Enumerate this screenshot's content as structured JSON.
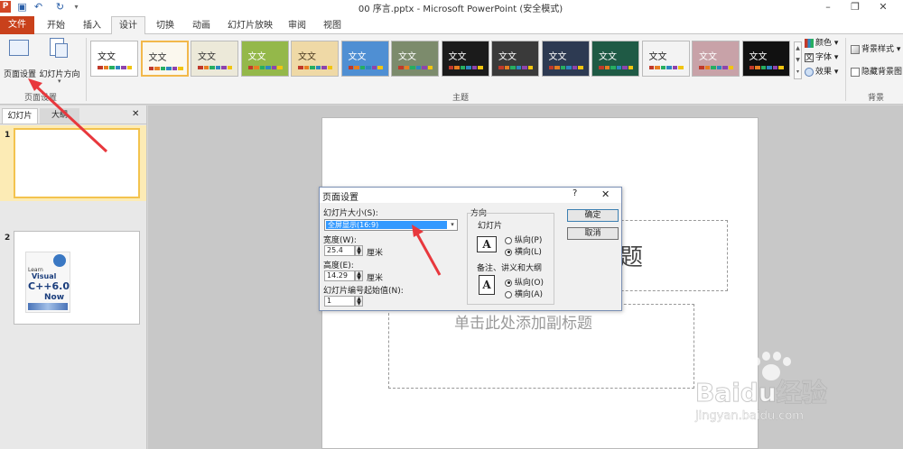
{
  "titlebar": {
    "title": "00 序言.pptx - Microsoft PowerPoint (安全模式)",
    "logo": "P",
    "qat_icons": [
      "save-icon",
      "undo-icon",
      "redo-icon",
      "customize-qat-icon"
    ],
    "window_controls": [
      "minimize-icon",
      "restore-icon",
      "close-icon"
    ]
  },
  "tabs": [
    "文件",
    "开始",
    "插入",
    "设计",
    "切换",
    "动画",
    "幻灯片放映",
    "审阅",
    "视图"
  ],
  "active_tab": "设计",
  "ribbon": {
    "page_setup_group": {
      "label": "页面设置",
      "page_setup_button": "页面设置",
      "orientation_button": "幻灯片方向"
    },
    "themes_group": {
      "label": "主题",
      "theme_text": "文文",
      "themes": [
        {
          "bg": "#ffffff",
          "fg": "#222222"
        },
        {
          "bg": "#fbf8ee",
          "fg": "#333333"
        },
        {
          "bg": "#ece9d9",
          "fg": "#333333"
        },
        {
          "bg": "#94b84a",
          "fg": "#ffffff"
        },
        {
          "bg": "#efd9a6",
          "fg": "#4a3a20"
        },
        {
          "bg": "#4f8fd3",
          "fg": "#ffffff"
        },
        {
          "bg": "#7c8b6c",
          "fg": "#ffffff"
        },
        {
          "bg": "#1b1b1b",
          "fg": "#ffffff"
        },
        {
          "bg": "#3a3a3a",
          "fg": "#ffffff"
        },
        {
          "bg": "#2d3a52",
          "fg": "#ffffff"
        },
        {
          "bg": "#1f5a45",
          "fg": "#ffffff"
        },
        {
          "bg": "#f3f3f3",
          "fg": "#222222"
        },
        {
          "bg": "#c8a2a8",
          "fg": "#ffffff"
        },
        {
          "bg": "#111111",
          "fg": "#ffffff"
        }
      ],
      "colors_label": "颜色",
      "fonts_label": "字体",
      "effects_label": "效果"
    },
    "background_group": {
      "label": "背景",
      "bg_styles_label": "背景样式",
      "hide_bg_label": "隐藏背景图"
    }
  },
  "left_pane": {
    "tabs": [
      "幻灯片",
      "大纲"
    ],
    "close": "✕",
    "thumbnails": [
      {
        "number": "1"
      },
      {
        "number": "2",
        "cover_lines": [
          "Learn",
          "Visual",
          "C++6.0",
          "Now"
        ]
      }
    ]
  },
  "slide": {
    "title_fragment": "题",
    "subtitle_placeholder": "单击此处添加副标题"
  },
  "dialog": {
    "title": "页面设置",
    "help": "?",
    "close": "✕",
    "size_label": "幻灯片大小(S):",
    "size_value": "全屏显示(16:9)",
    "width_label": "宽度(W):",
    "width_value": "25.4",
    "width_unit": "厘米",
    "height_label": "高度(E):",
    "height_value": "14.29",
    "height_unit": "厘米",
    "start_label": "幻灯片编号起始值(N):",
    "start_value": "1",
    "orientation_label": "方向",
    "slides_label": "幻灯片",
    "portrait_label": "纵向(P)",
    "landscape_label": "横向(L)",
    "notes_label": "备注、讲义和大纲",
    "notes_portrait_label": "纵向(O)",
    "notes_landscape_label": "横向(A)",
    "ok_label": "确定",
    "cancel_label": "取消"
  },
  "watermark": {
    "brand": "Baidu经验",
    "url": "jingyan.baidu.com"
  },
  "colors": {
    "file_tab": "#c9411b",
    "selected_theme": "#f2b84b",
    "annotation_arrow": "#e8383d",
    "selection": "#3399ff"
  }
}
